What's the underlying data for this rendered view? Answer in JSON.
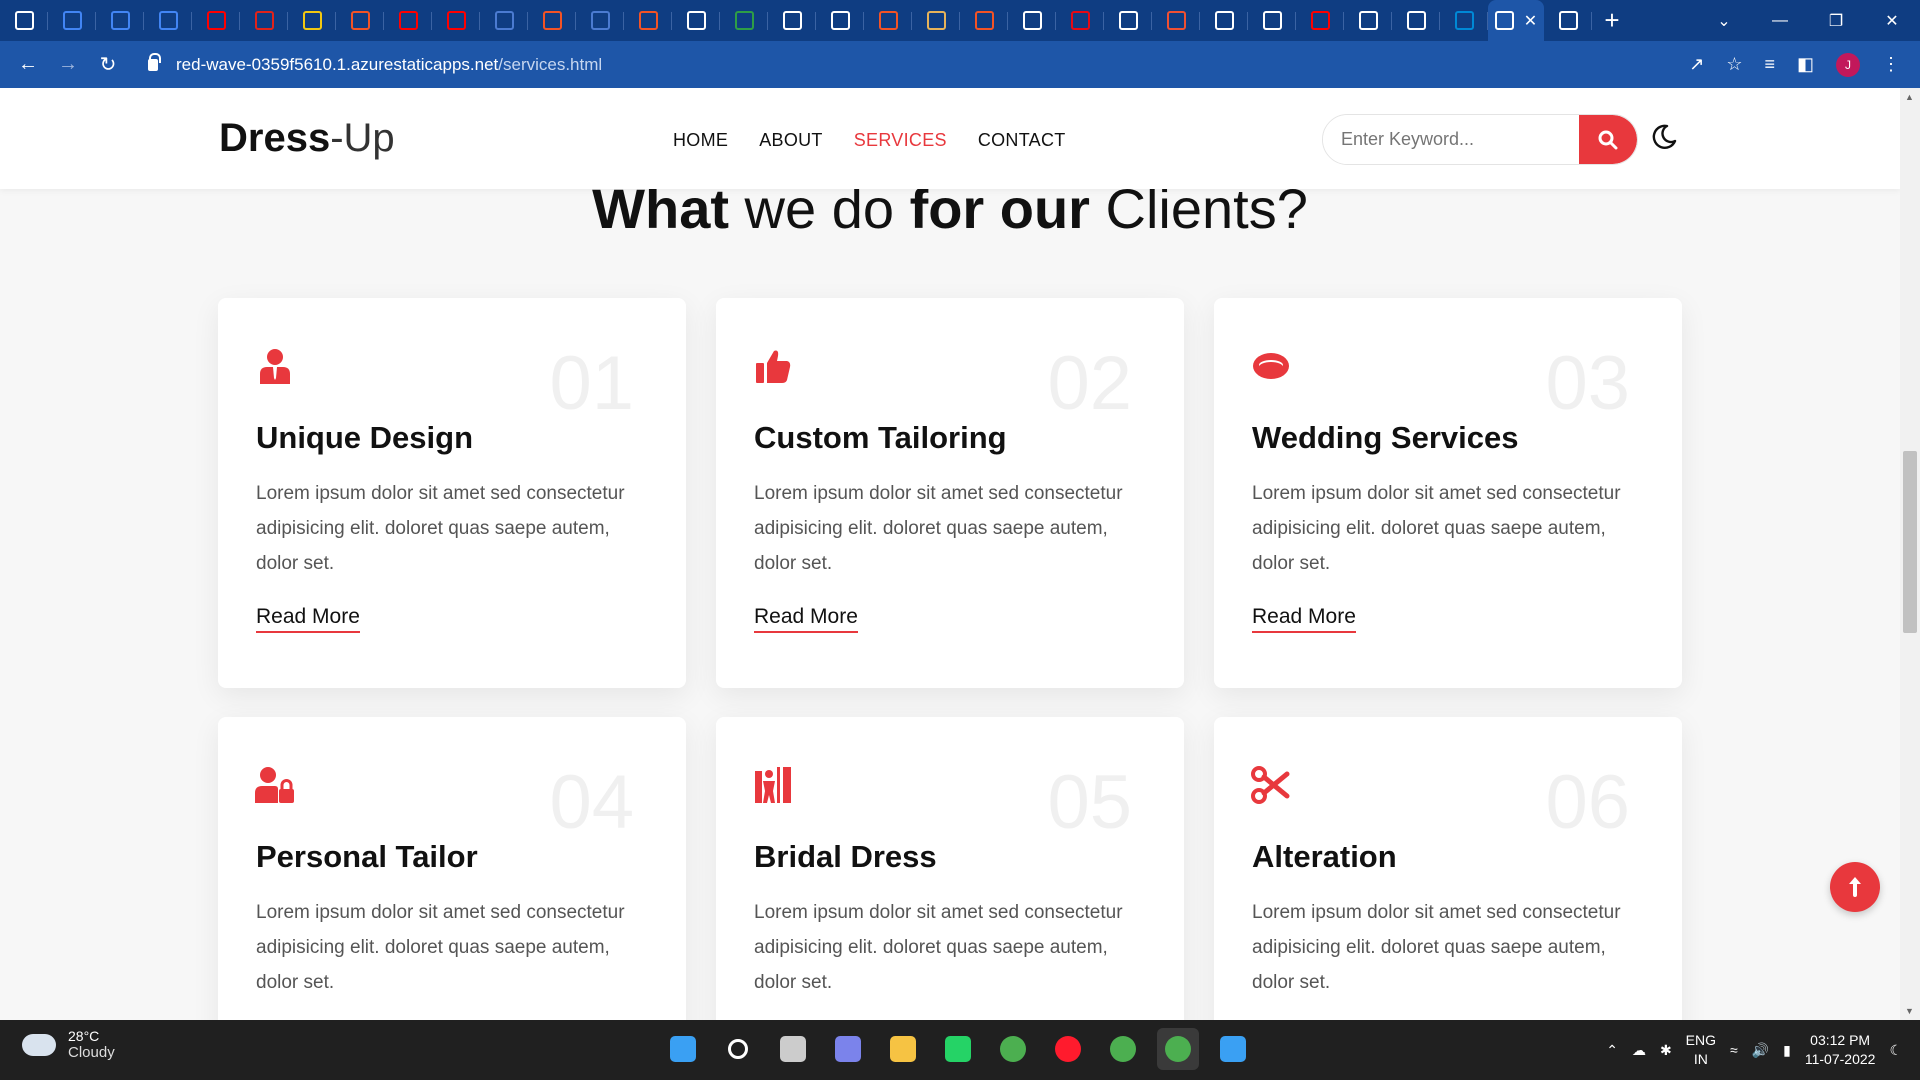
{
  "browser": {
    "tabs": [
      {
        "icon": "app-grid-icon",
        "color": "#ffffff",
        "active": false
      },
      {
        "icon": "google-cloud-icon",
        "color": "#4285f4",
        "active": false
      },
      {
        "icon": "google-cloud-icon",
        "color": "#4285f4",
        "active": false
      },
      {
        "icon": "google-cloud-icon",
        "color": "#4285f4",
        "active": false
      },
      {
        "icon": "youtube-icon",
        "color": "#ff0000",
        "active": false
      },
      {
        "icon": "acrobat-icon",
        "color": "#e2231a",
        "active": false
      },
      {
        "icon": "power-bi-icon",
        "color": "#f2c811",
        "active": false
      },
      {
        "icon": "microsoft-icon",
        "color": "#f35325",
        "active": false
      },
      {
        "icon": "youtube-icon",
        "color": "#ff0000",
        "active": false
      },
      {
        "icon": "youtube-icon",
        "color": "#ff0000",
        "active": false
      },
      {
        "icon": "docs-icon",
        "color": "#4b7bd1",
        "active": false
      },
      {
        "icon": "microsoft-icon",
        "color": "#f35325",
        "active": false
      },
      {
        "icon": "docs-icon",
        "color": "#4b7bd1",
        "active": false
      },
      {
        "icon": "microsoft-icon",
        "color": "#f35325",
        "active": false
      },
      {
        "icon": "mountain-icon",
        "color": "#ffffff",
        "active": false
      },
      {
        "icon": "w-icon",
        "color": "#2e9e46",
        "active": false
      },
      {
        "icon": "google-icon",
        "color": "#ffffff",
        "active": false
      },
      {
        "icon": "w3schools-icon",
        "color": "#ffffff",
        "active": false
      },
      {
        "icon": "microsoft-icon",
        "color": "#f35325",
        "active": false
      },
      {
        "icon": "sun-icon",
        "color": "#e6b35a",
        "active": false
      },
      {
        "icon": "microsoft-icon",
        "color": "#f35325",
        "active": false
      },
      {
        "icon": "github-icon",
        "color": "#ffffff",
        "active": false
      },
      {
        "icon": "netflix-icon",
        "color": "#e50914",
        "active": false
      },
      {
        "icon": "github-icon",
        "color": "#ffffff",
        "active": false
      },
      {
        "icon": "git-icon",
        "color": "#f05032",
        "active": false
      },
      {
        "icon": "globe-icon",
        "color": "#ffffff",
        "active": false
      },
      {
        "icon": "github-icon",
        "color": "#ffffff",
        "active": false
      },
      {
        "icon": "youtube-icon",
        "color": "#ff0000",
        "active": false
      },
      {
        "icon": "github-icon",
        "color": "#ffffff",
        "active": false
      },
      {
        "icon": "github-icon",
        "color": "#ffffff",
        "active": false
      },
      {
        "icon": "azure-icon",
        "color": "#0089d6",
        "active": false
      },
      {
        "icon": "page-icon",
        "color": "#ffffff",
        "active": true
      },
      {
        "icon": "github-icon",
        "color": "#ffffff",
        "active": false
      }
    ],
    "url_host": "red-wave-0359f5610.1.azurestaticapps.net",
    "url_path": "/services.html",
    "profile_initial": "J"
  },
  "site": {
    "logo_bold": "Dress",
    "logo_rest": "-Up",
    "nav": [
      {
        "label": "HOME",
        "active": false
      },
      {
        "label": "ABOUT",
        "active": false
      },
      {
        "label": "SERVICES",
        "active": true
      },
      {
        "label": "CONTACT",
        "active": false
      }
    ],
    "search_placeholder": "Enter Keyword...",
    "accent": "#e8383d"
  },
  "heading": {
    "part1": "What",
    "part2": " we do ",
    "part3": "for our",
    "part4": " Clients?"
  },
  "services": [
    {
      "num": "01",
      "title": "Unique Design",
      "icon": "user-tie-icon",
      "text": "Lorem ipsum dolor sit amet sed consectetur adipisicing elit. doloret quas saepe autem, dolor set.",
      "link": "Read More"
    },
    {
      "num": "02",
      "title": "Custom Tailoring",
      "icon": "thumbs-up-icon",
      "text": "Lorem ipsum dolor sit amet sed consectetur adipisicing elit. doloret quas saepe autem, dolor set.",
      "link": "Read More"
    },
    {
      "num": "03",
      "title": "Wedding Services",
      "icon": "ring-icon",
      "text": "Lorem ipsum dolor sit amet sed consectetur adipisicing elit. doloret quas saepe autem, dolor set.",
      "link": "Read More"
    },
    {
      "num": "04",
      "title": "Personal Tailor",
      "icon": "user-lock-icon",
      "text": "Lorem ipsum dolor sit amet sed consectetur adipisicing elit. doloret quas saepe autem, dolor set.",
      "link": "Read More"
    },
    {
      "num": "05",
      "title": "Bridal Dress",
      "icon": "person-booth-icon",
      "text": "Lorem ipsum dolor sit amet sed consectetur adipisicing elit. doloret quas saepe autem, dolor set.",
      "link": "Read More"
    },
    {
      "num": "06",
      "title": "Alteration",
      "icon": "scissors-icon",
      "text": "Lorem ipsum dolor sit amet sed consectetur adipisicing elit. doloret quas saepe autem, dolor set.",
      "link": "Read More"
    }
  ],
  "taskbar": {
    "temp": "28°C",
    "condition": "Cloudy",
    "apps": [
      {
        "icon": "windows-start-icon",
        "color": "#3aa0f3",
        "active": false
      },
      {
        "icon": "search-icon",
        "color": "#ffffff",
        "active": false
      },
      {
        "icon": "task-view-icon",
        "color": "#cccccc",
        "active": false
      },
      {
        "icon": "teams-chat-icon",
        "color": "#7b83eb",
        "active": false
      },
      {
        "icon": "file-explorer-icon",
        "color": "#f6c343",
        "active": false
      },
      {
        "icon": "whatsapp-icon",
        "color": "#25d366",
        "active": false
      },
      {
        "icon": "chrome-icon",
        "color": "#4caf50",
        "active": false
      },
      {
        "icon": "opera-icon",
        "color": "#ff1b2d",
        "active": false
      },
      {
        "icon": "chrome-profile-icon",
        "color": "#4caf50",
        "active": false
      },
      {
        "icon": "chrome-profile-icon",
        "color": "#4caf50",
        "active": true
      },
      {
        "icon": "notepad-icon",
        "color": "#3aa0f3",
        "active": false
      }
    ],
    "lang1": "ENG",
    "lang2": "IN",
    "time": "03:12 PM",
    "date": "11-07-2022"
  }
}
